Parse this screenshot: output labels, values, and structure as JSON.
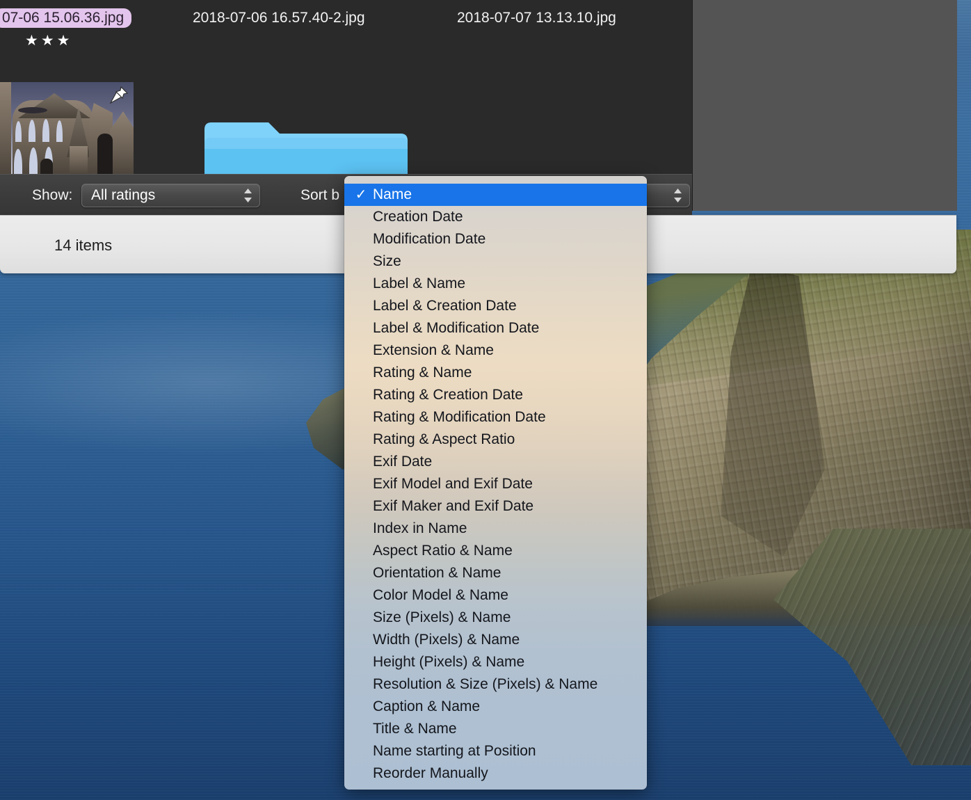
{
  "desktop": {
    "wallpaper_description": "coastal cliff and blue sea photograph"
  },
  "window": {
    "browser": {
      "files": [
        {
          "name": "07-06 15.06.36.jpg",
          "selected": true,
          "rating": "★★★"
        },
        {
          "name": "2018-07-06 16.57.40-2.jpg",
          "selected": false,
          "rating": ""
        },
        {
          "name": "2018-07-07 13.13.10.jpg",
          "selected": false,
          "rating": ""
        }
      ],
      "thumbnail_alt": "abbey-ruins-thumbnail",
      "pin_icon": "pushpin-icon",
      "folder_icon": "blue-folder-icon"
    },
    "toolbar": {
      "show_label": "Show:",
      "show_value": "All ratings",
      "sort_label": "Sort b",
      "sort_label_full": "Sort by:",
      "stepper_icon": "up-down-stepper-icon"
    },
    "statusbar": {
      "item_count": "14 items"
    }
  },
  "sort_menu": {
    "check_glyph": "✓",
    "selected_index": 0,
    "items": [
      "Name",
      "Creation Date",
      "Modification Date",
      "Size",
      "Label & Name",
      "Label & Creation Date",
      "Label & Modification Date",
      "Extension & Name",
      "Rating & Name",
      "Rating & Creation Date",
      "Rating & Modification Date",
      "Rating & Aspect Ratio",
      "Exif Date",
      "Exif Model and Exif Date",
      "Exif Maker and Exif Date",
      "Index in Name",
      "Aspect Ratio & Name",
      "Orientation & Name",
      "Color Model & Name",
      "Size (Pixels) & Name",
      "Width (Pixels) & Name",
      "Height (Pixels) & Name",
      "Resolution & Size (Pixels) & Name",
      "Caption & Name",
      "Title & Name",
      "Name starting at Position",
      "Reorder Manually"
    ]
  },
  "colors": {
    "highlight_blue": "#1874e8",
    "selected_label_bg": "#e3c4ec",
    "browser_bg": "#2a2a2a",
    "preview_bg": "#555454",
    "toolbar_bg": "#3b3b3b",
    "statusbar_bg": "#e8e8e8",
    "folder_blue": "#6ec6f5"
  }
}
